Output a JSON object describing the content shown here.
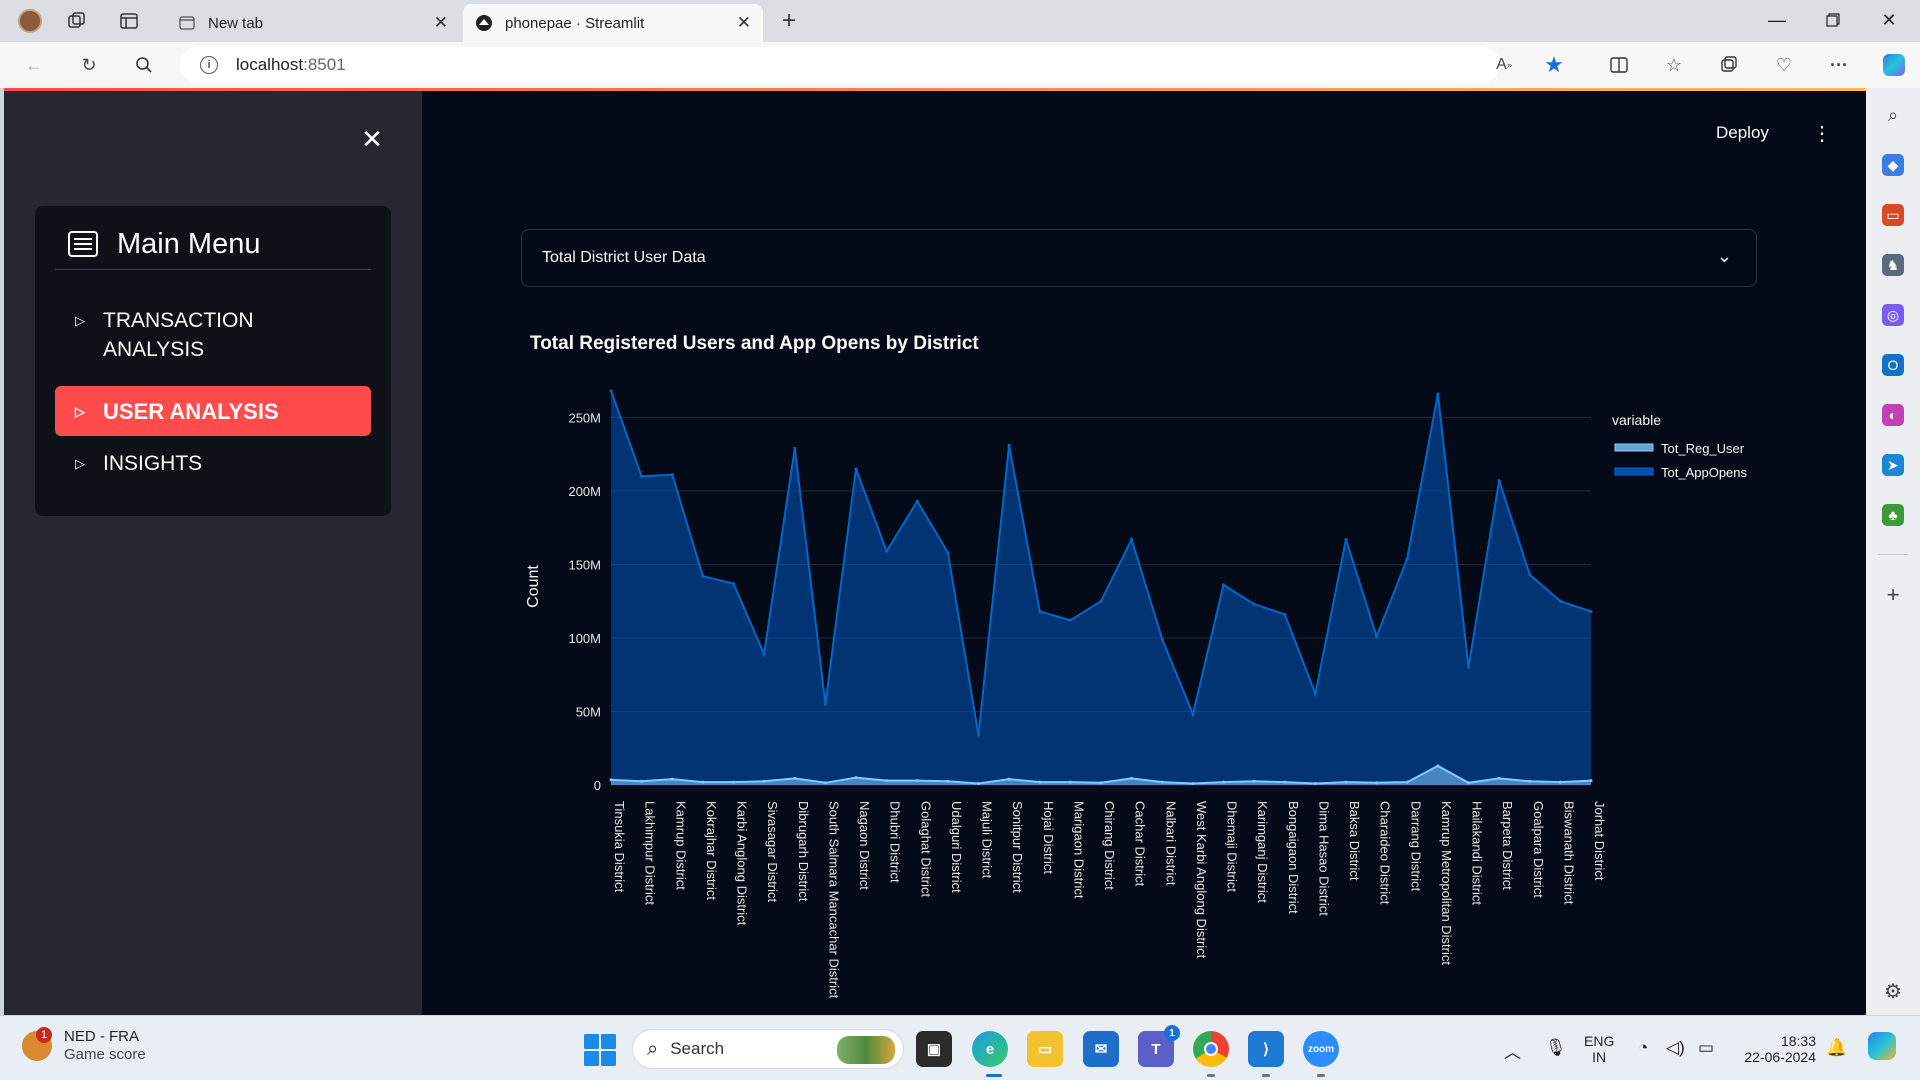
{
  "browser": {
    "tabs": [
      {
        "label": "New tab",
        "active": false
      },
      {
        "label": "phonepae · Streamlit",
        "active": true
      }
    ],
    "url_host": "localhost",
    "url_port": ":8501"
  },
  "sidebar": {
    "menu_title": "Main Menu",
    "items": [
      {
        "label": "TRANSACTION ANALYSIS",
        "selected": false
      },
      {
        "label": "USER ANALYSIS",
        "selected": true
      },
      {
        "label": "INSIGHTS",
        "selected": false
      }
    ]
  },
  "header": {
    "deploy_label": "Deploy"
  },
  "selectbox": {
    "value": "Total District User Data"
  },
  "chart_data": {
    "type": "area",
    "title": "Total Registered Users and App Opens by District",
    "ylabel": "Count",
    "xlabel": "",
    "ylim": [
      0,
      270000000
    ],
    "yticks": [
      {
        "value": 0,
        "label": "0"
      },
      {
        "value": 50000000,
        "label": "50M"
      },
      {
        "value": 100000000,
        "label": "100M"
      },
      {
        "value": 150000000,
        "label": "150M"
      },
      {
        "value": 200000000,
        "label": "200M"
      },
      {
        "value": 250000000,
        "label": "250M"
      }
    ],
    "legend_title": "variable",
    "legend_position": "top-right",
    "grid": true,
    "categories": [
      "Tinsukia District",
      "Lakhimpur District",
      "Kamrup District",
      "Kokrajhar District",
      "Karbi Anglong District",
      "Sivasagar District",
      "Dibrugarh District",
      "South Salmara Mancachar District",
      "Nagaon District",
      "Dhubri District",
      "Golaghat District",
      "Udalguri District",
      "Majuli District",
      "Sonitpur District",
      "Hojai District",
      "Marigaon District",
      "Chirang District",
      "Cachar District",
      "Nalbari District",
      "West Karbi Anglong District",
      "Dhemaji District",
      "Karimganj District",
      "Bongaigaon District",
      "Dima Hasao District",
      "Baksa District",
      "Charaideo District",
      "Darrang District",
      "Kamrup Metropolitan District",
      "Hailakandi District",
      "Barpeta District",
      "Goalpara District",
      "Biswanath District",
      "Jorhat District"
    ],
    "series": [
      {
        "name": "Tot_Reg_User",
        "color": "#83c9ff",
        "values": [
          3500000,
          2500000,
          4000000,
          2000000,
          2000000,
          2500000,
          4500000,
          1500000,
          5000000,
          3000000,
          3000000,
          2500000,
          1000000,
          4000000,
          2000000,
          2000000,
          1500000,
          4500000,
          2000000,
          1000000,
          2000000,
          2500000,
          2000000,
          1000000,
          2000000,
          1500000,
          2000000,
          13000000,
          1500000,
          4500000,
          2500000,
          2000000,
          3000000
        ]
      },
      {
        "name": "Tot_AppOpens",
        "color": "#0068c9",
        "values": [
          268000000,
          210000000,
          211000000,
          142000000,
          137000000,
          89000000,
          229000000,
          55000000,
          215000000,
          159000000,
          193000000,
          158000000,
          34000000,
          231000000,
          118000000,
          112000000,
          125000000,
          167000000,
          99000000,
          48000000,
          136000000,
          123000000,
          116000000,
          62000000,
          167000000,
          101000000,
          154000000,
          266000000,
          80000000,
          207000000,
          143000000,
          125000000,
          118000000
        ]
      }
    ]
  },
  "taskbar": {
    "weather_title": "NED - FRA",
    "weather_sub": "Game score",
    "weather_badge": "1",
    "search_placeholder": "Search",
    "teams_badge": "1",
    "lang_top": "ENG",
    "lang_bottom": "IN",
    "time": "18:33",
    "date": "22-06-2024"
  }
}
